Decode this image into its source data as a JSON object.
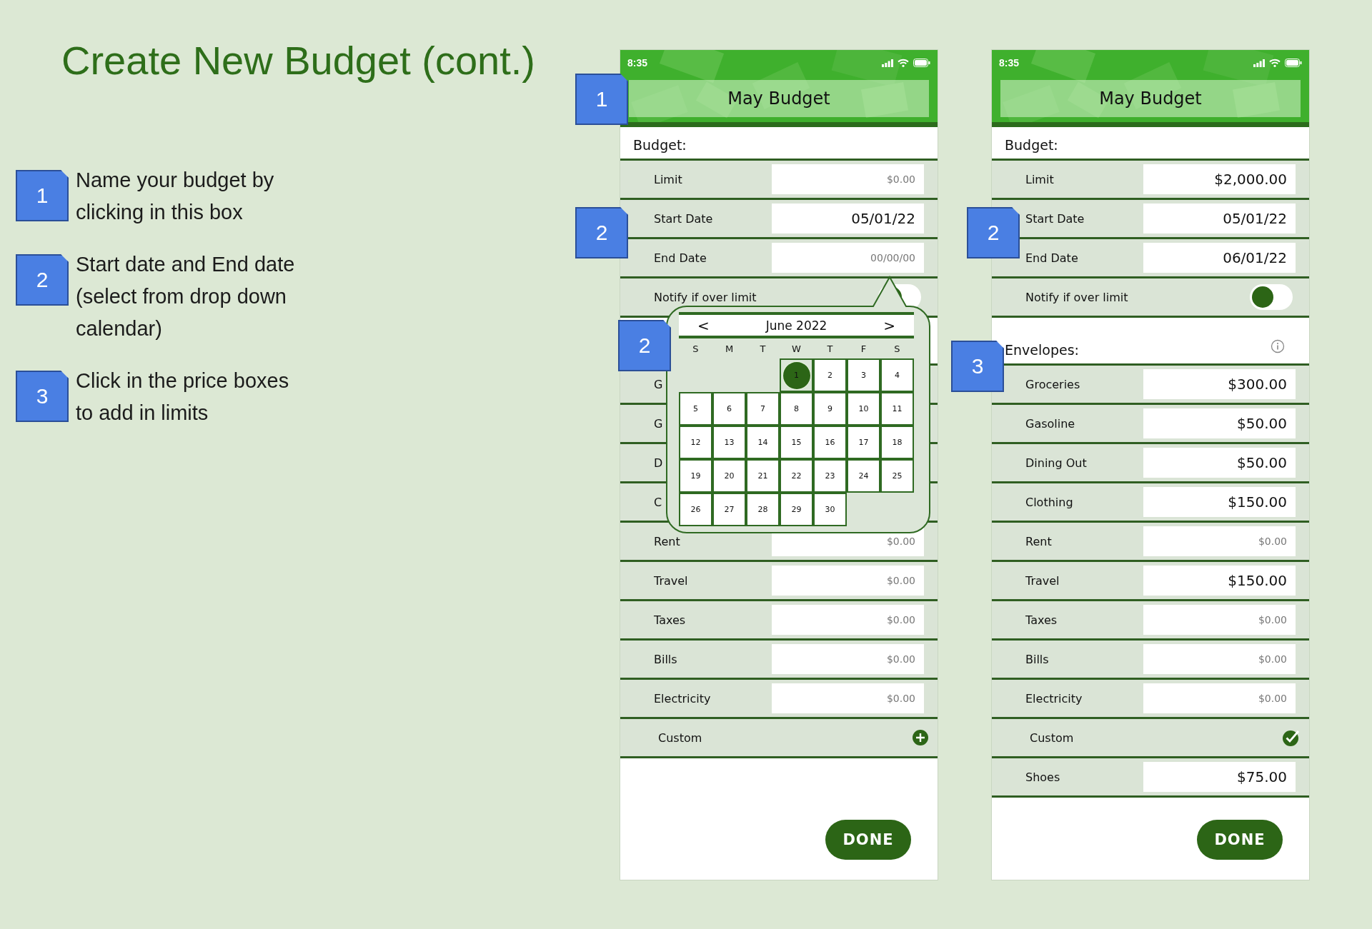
{
  "title": "Create New Budget (cont.)",
  "steps": [
    {
      "marker": "1",
      "text": "Name your budget by clicking in this box"
    },
    {
      "marker": "2",
      "text": "Start date and End date (select from drop down calendar)"
    },
    {
      "marker": "3",
      "text": "Click in the price boxes to add in limits"
    }
  ],
  "phones": [
    {
      "status_time": "8:35",
      "budget_name": "May Budget",
      "sections": [
        {
          "label": "Budget:",
          "rows": [
            {
              "kind": "field",
              "label": "Limit",
              "placeholder": "$0.00"
            },
            {
              "kind": "field",
              "label": "Start Date",
              "value": "05/01/22"
            },
            {
              "kind": "field",
              "label": "End Date",
              "placeholder": "00/00/00"
            },
            {
              "kind": "toggle",
              "label": "Notify if over limit",
              "on": false
            }
          ]
        },
        {
          "rows": [
            {
              "kind": "field",
              "label": "G"
            },
            {
              "kind": "field",
              "label": "G"
            },
            {
              "kind": "field",
              "label": "D"
            },
            {
              "kind": "field",
              "label": "C"
            },
            {
              "kind": "field",
              "label": "Rent",
              "placeholder": "$0.00"
            },
            {
              "kind": "field",
              "label": "Travel",
              "placeholder": "$0.00"
            },
            {
              "kind": "field",
              "label": "Taxes",
              "placeholder": "$0.00"
            },
            {
              "kind": "field",
              "label": "Bills",
              "placeholder": "$0.00"
            },
            {
              "kind": "field",
              "label": "Electricity",
              "placeholder": "$0.00"
            },
            {
              "kind": "custom",
              "label": "Custom",
              "checked": false
            }
          ]
        }
      ],
      "calendar": {
        "prev": "<",
        "month": "June 2022",
        "next": ">",
        "weekdays": [
          "S",
          "M",
          "T",
          "W",
          "T",
          "F",
          "S"
        ],
        "weeks": [
          {
            "days": [
              {
                "day": "1",
                "selected": true
              },
              {
                "day": "2",
                "selected": false
              },
              {
                "day": "3",
                "selected": false
              },
              {
                "day": "4",
                "selected": false
              }
            ]
          },
          {
            "days": [
              {
                "day": "5",
                "selected": false
              },
              {
                "day": "6",
                "selected": false
              },
              {
                "day": "7",
                "selected": false
              },
              {
                "day": "8",
                "selected": false
              },
              {
                "day": "9",
                "selected": false
              },
              {
                "day": "10",
                "selected": false
              },
              {
                "day": "11",
                "selected": false
              }
            ]
          },
          {
            "days": [
              {
                "day": "12",
                "selected": false
              },
              {
                "day": "13",
                "selected": false
              },
              {
                "day": "14",
                "selected": false
              },
              {
                "day": "15",
                "selected": false
              },
              {
                "day": "16",
                "selected": false
              },
              {
                "day": "17",
                "selected": false
              },
              {
                "day": "18",
                "selected": false
              }
            ]
          },
          {
            "days": [
              {
                "day": "19",
                "selected": false
              },
              {
                "day": "20",
                "selected": false
              },
              {
                "day": "21",
                "selected": false
              },
              {
                "day": "22",
                "selected": false
              },
              {
                "day": "23",
                "selected": false
              },
              {
                "day": "24",
                "selected": false
              },
              {
                "day": "25",
                "selected": false
              }
            ]
          },
          {
            "days": [
              {
                "day": "26",
                "selected": false
              },
              {
                "day": "27",
                "selected": false
              },
              {
                "day": "28",
                "selected": false
              },
              {
                "day": "29",
                "selected": false
              },
              {
                "day": "30",
                "selected": false
              }
            ]
          }
        ]
      },
      "callouts": [
        {
          "label": "1"
        },
        {
          "label": "2"
        },
        {
          "label": "2"
        }
      ],
      "done_button": "DONE"
    },
    {
      "status_time": "8:35",
      "budget_name": "May Budget",
      "sections": [
        {
          "label": "Budget:",
          "rows": [
            {
              "kind": "field",
              "label": "Limit",
              "value": "$2,000.00"
            },
            {
              "kind": "field",
              "label": "Start Date",
              "value": "05/01/22"
            },
            {
              "kind": "field",
              "label": "End Date",
              "value": "06/01/22"
            },
            {
              "kind": "toggle",
              "label": "Notify if over limit",
              "on": false
            }
          ]
        },
        {
          "label": "Envelopes:",
          "info_icon": true,
          "rows": [
            {
              "kind": "field",
              "label": "Groceries",
              "value": "$300.00"
            },
            {
              "kind": "field",
              "label": "Gasoline",
              "value": "$50.00"
            },
            {
              "kind": "field",
              "label": "Dining Out",
              "value": "$50.00"
            },
            {
              "kind": "field",
              "label": "Clothing",
              "value": "$150.00"
            },
            {
              "kind": "field",
              "label": "Rent",
              "placeholder": "$0.00"
            },
            {
              "kind": "field",
              "label": "Travel",
              "value": "$150.00"
            },
            {
              "kind": "field",
              "label": "Taxes",
              "placeholder": "$0.00"
            },
            {
              "kind": "field",
              "label": "Bills",
              "placeholder": "$0.00"
            },
            {
              "kind": "field",
              "label": "Electricity",
              "placeholder": "$0.00"
            },
            {
              "kind": "custom",
              "label": "Custom",
              "checked": true
            },
            {
              "kind": "field",
              "label": "Shoes",
              "value": "$75.00"
            }
          ]
        }
      ],
      "callouts": [
        {
          "label": "2"
        },
        {
          "label": "3"
        }
      ],
      "done_button": "DONE"
    }
  ]
}
